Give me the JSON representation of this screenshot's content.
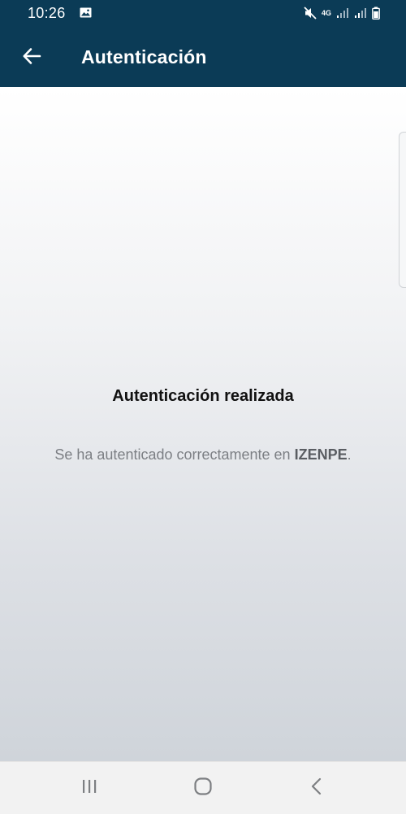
{
  "status_bar": {
    "time": "10:26",
    "network_label": "4G"
  },
  "app_bar": {
    "title": "Autenticación",
    "back_icon": "arrow-left-icon",
    "background_color": "#0b3b56"
  },
  "main": {
    "title": "Autenticación realizada",
    "message_prefix": "Se ha autenticado correctamente en ",
    "message_entity": "IZENPE",
    "message_suffix": "."
  },
  "nav_bar": {
    "icons": [
      "recents-icon",
      "home-icon",
      "back-icon"
    ]
  }
}
